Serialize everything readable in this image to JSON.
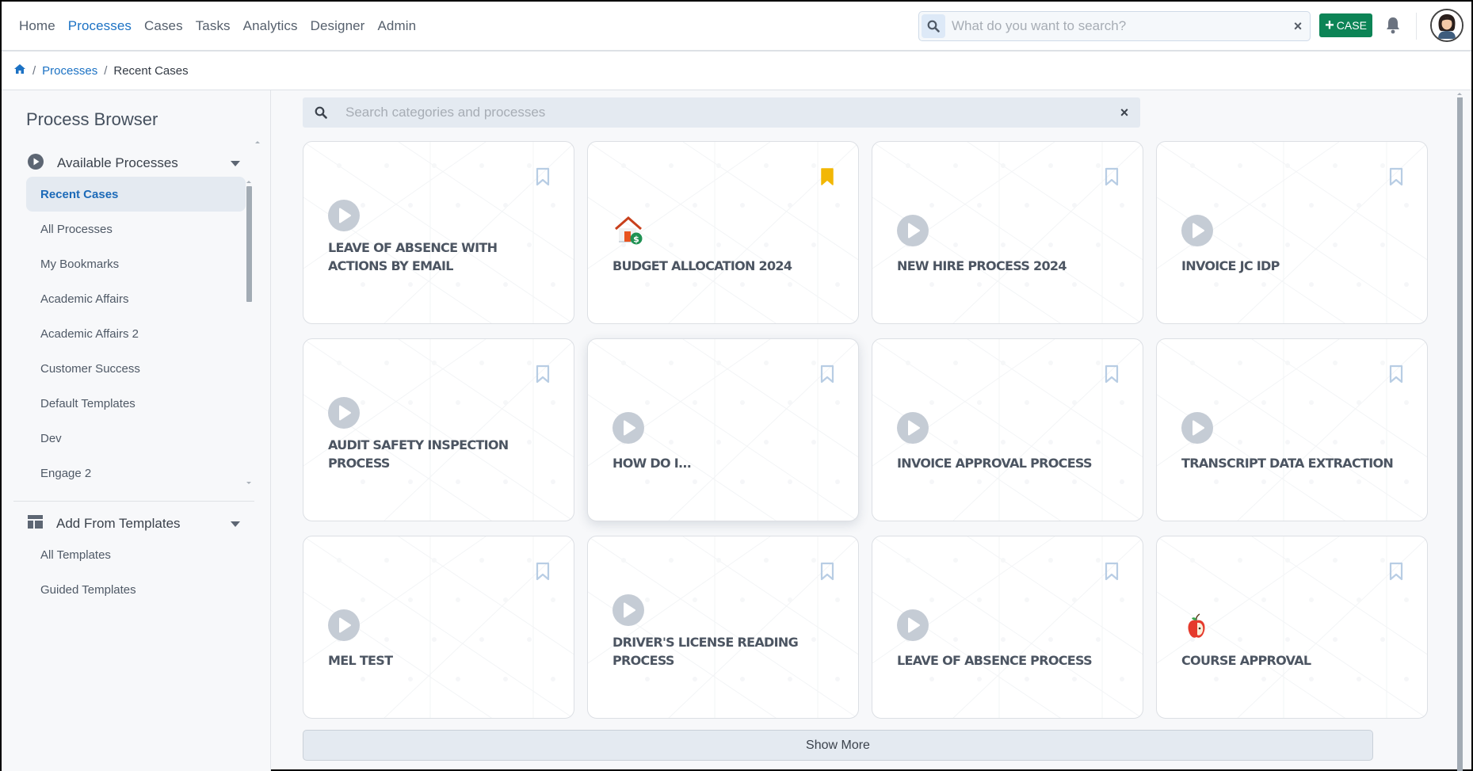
{
  "topbar": {
    "nav": [
      {
        "label": "Home",
        "active": false
      },
      {
        "label": "Processes",
        "active": true
      },
      {
        "label": "Cases",
        "active": false
      },
      {
        "label": "Tasks",
        "active": false
      },
      {
        "label": "Analytics",
        "active": false
      },
      {
        "label": "Designer",
        "active": false
      },
      {
        "label": "Admin",
        "active": false
      }
    ],
    "search_placeholder": "What do you want to search?",
    "search_value": "",
    "clear_label": "×",
    "case_button_plus": "+",
    "case_button_label": "CASE"
  },
  "breadcrumb": {
    "home_icon": "home-icon",
    "separator": "/",
    "items": [
      "Processes",
      "Recent Cases"
    ]
  },
  "sidebar": {
    "title": "Process Browser",
    "sections": [
      {
        "label": "Available Processes",
        "icon": "play-circle-icon",
        "items": [
          {
            "label": "Recent Cases",
            "active": true
          },
          {
            "label": "All Processes",
            "active": false
          },
          {
            "label": "My Bookmarks",
            "active": false
          },
          {
            "label": "Academic Affairs",
            "active": false
          },
          {
            "label": "Academic Affairs 2",
            "active": false
          },
          {
            "label": "Customer Success",
            "active": false
          },
          {
            "label": "Default Templates",
            "active": false
          },
          {
            "label": "Dev",
            "active": false
          },
          {
            "label": "Engage 2",
            "active": false
          }
        ]
      },
      {
        "label": "Add From Templates",
        "icon": "template-icon",
        "items": [
          {
            "label": "All Templates",
            "active": false
          },
          {
            "label": "Guided Templates",
            "active": false
          }
        ]
      }
    ]
  },
  "main": {
    "search_placeholder": "Search categories and processes",
    "search_value": "",
    "clear_label": "×",
    "colors": {
      "bookmark_empty": "#b8cde4",
      "bookmark_filled": "#f2b705",
      "play_icon": "#c5ccd5",
      "accent": "#1c72c4",
      "case_button": "#0c8456"
    },
    "cards": [
      {
        "title": "Leave of Absence with Actions by Email",
        "icon": "play-circle-icon",
        "bookmarked": false,
        "lines": 2
      },
      {
        "title": "Budget Allocation 2024",
        "icon": "house-dollar-icon",
        "bookmarked": true,
        "lines": 1
      },
      {
        "title": "New Hire Process 2024",
        "icon": "play-circle-icon",
        "bookmarked": false,
        "lines": 1
      },
      {
        "title": "Invoice JC IDP",
        "icon": "play-circle-icon",
        "bookmarked": false,
        "lines": 1
      },
      {
        "title": "Audit Safety Inspection Process",
        "icon": "play-circle-icon",
        "bookmarked": false,
        "lines": 2
      },
      {
        "title": "How do I...",
        "icon": "play-circle-icon",
        "bookmarked": false,
        "lines": 1,
        "hover": true
      },
      {
        "title": "Invoice Approval Process",
        "icon": "play-circle-icon",
        "bookmarked": false,
        "lines": 1
      },
      {
        "title": "Transcript Data Extraction",
        "icon": "play-circle-icon",
        "bookmarked": false,
        "lines": 1
      },
      {
        "title": "MEL Test",
        "icon": "play-circle-icon",
        "bookmarked": false,
        "lines": 1
      },
      {
        "title": "Driver's License Reading Process",
        "icon": "play-circle-icon",
        "bookmarked": false,
        "lines": 2
      },
      {
        "title": "Leave of Absence Process",
        "icon": "play-circle-icon",
        "bookmarked": false,
        "lines": 1
      },
      {
        "title": "Course Approval",
        "icon": "apple-icon",
        "bookmarked": false,
        "lines": 1
      }
    ],
    "show_more_label": "Show More"
  }
}
